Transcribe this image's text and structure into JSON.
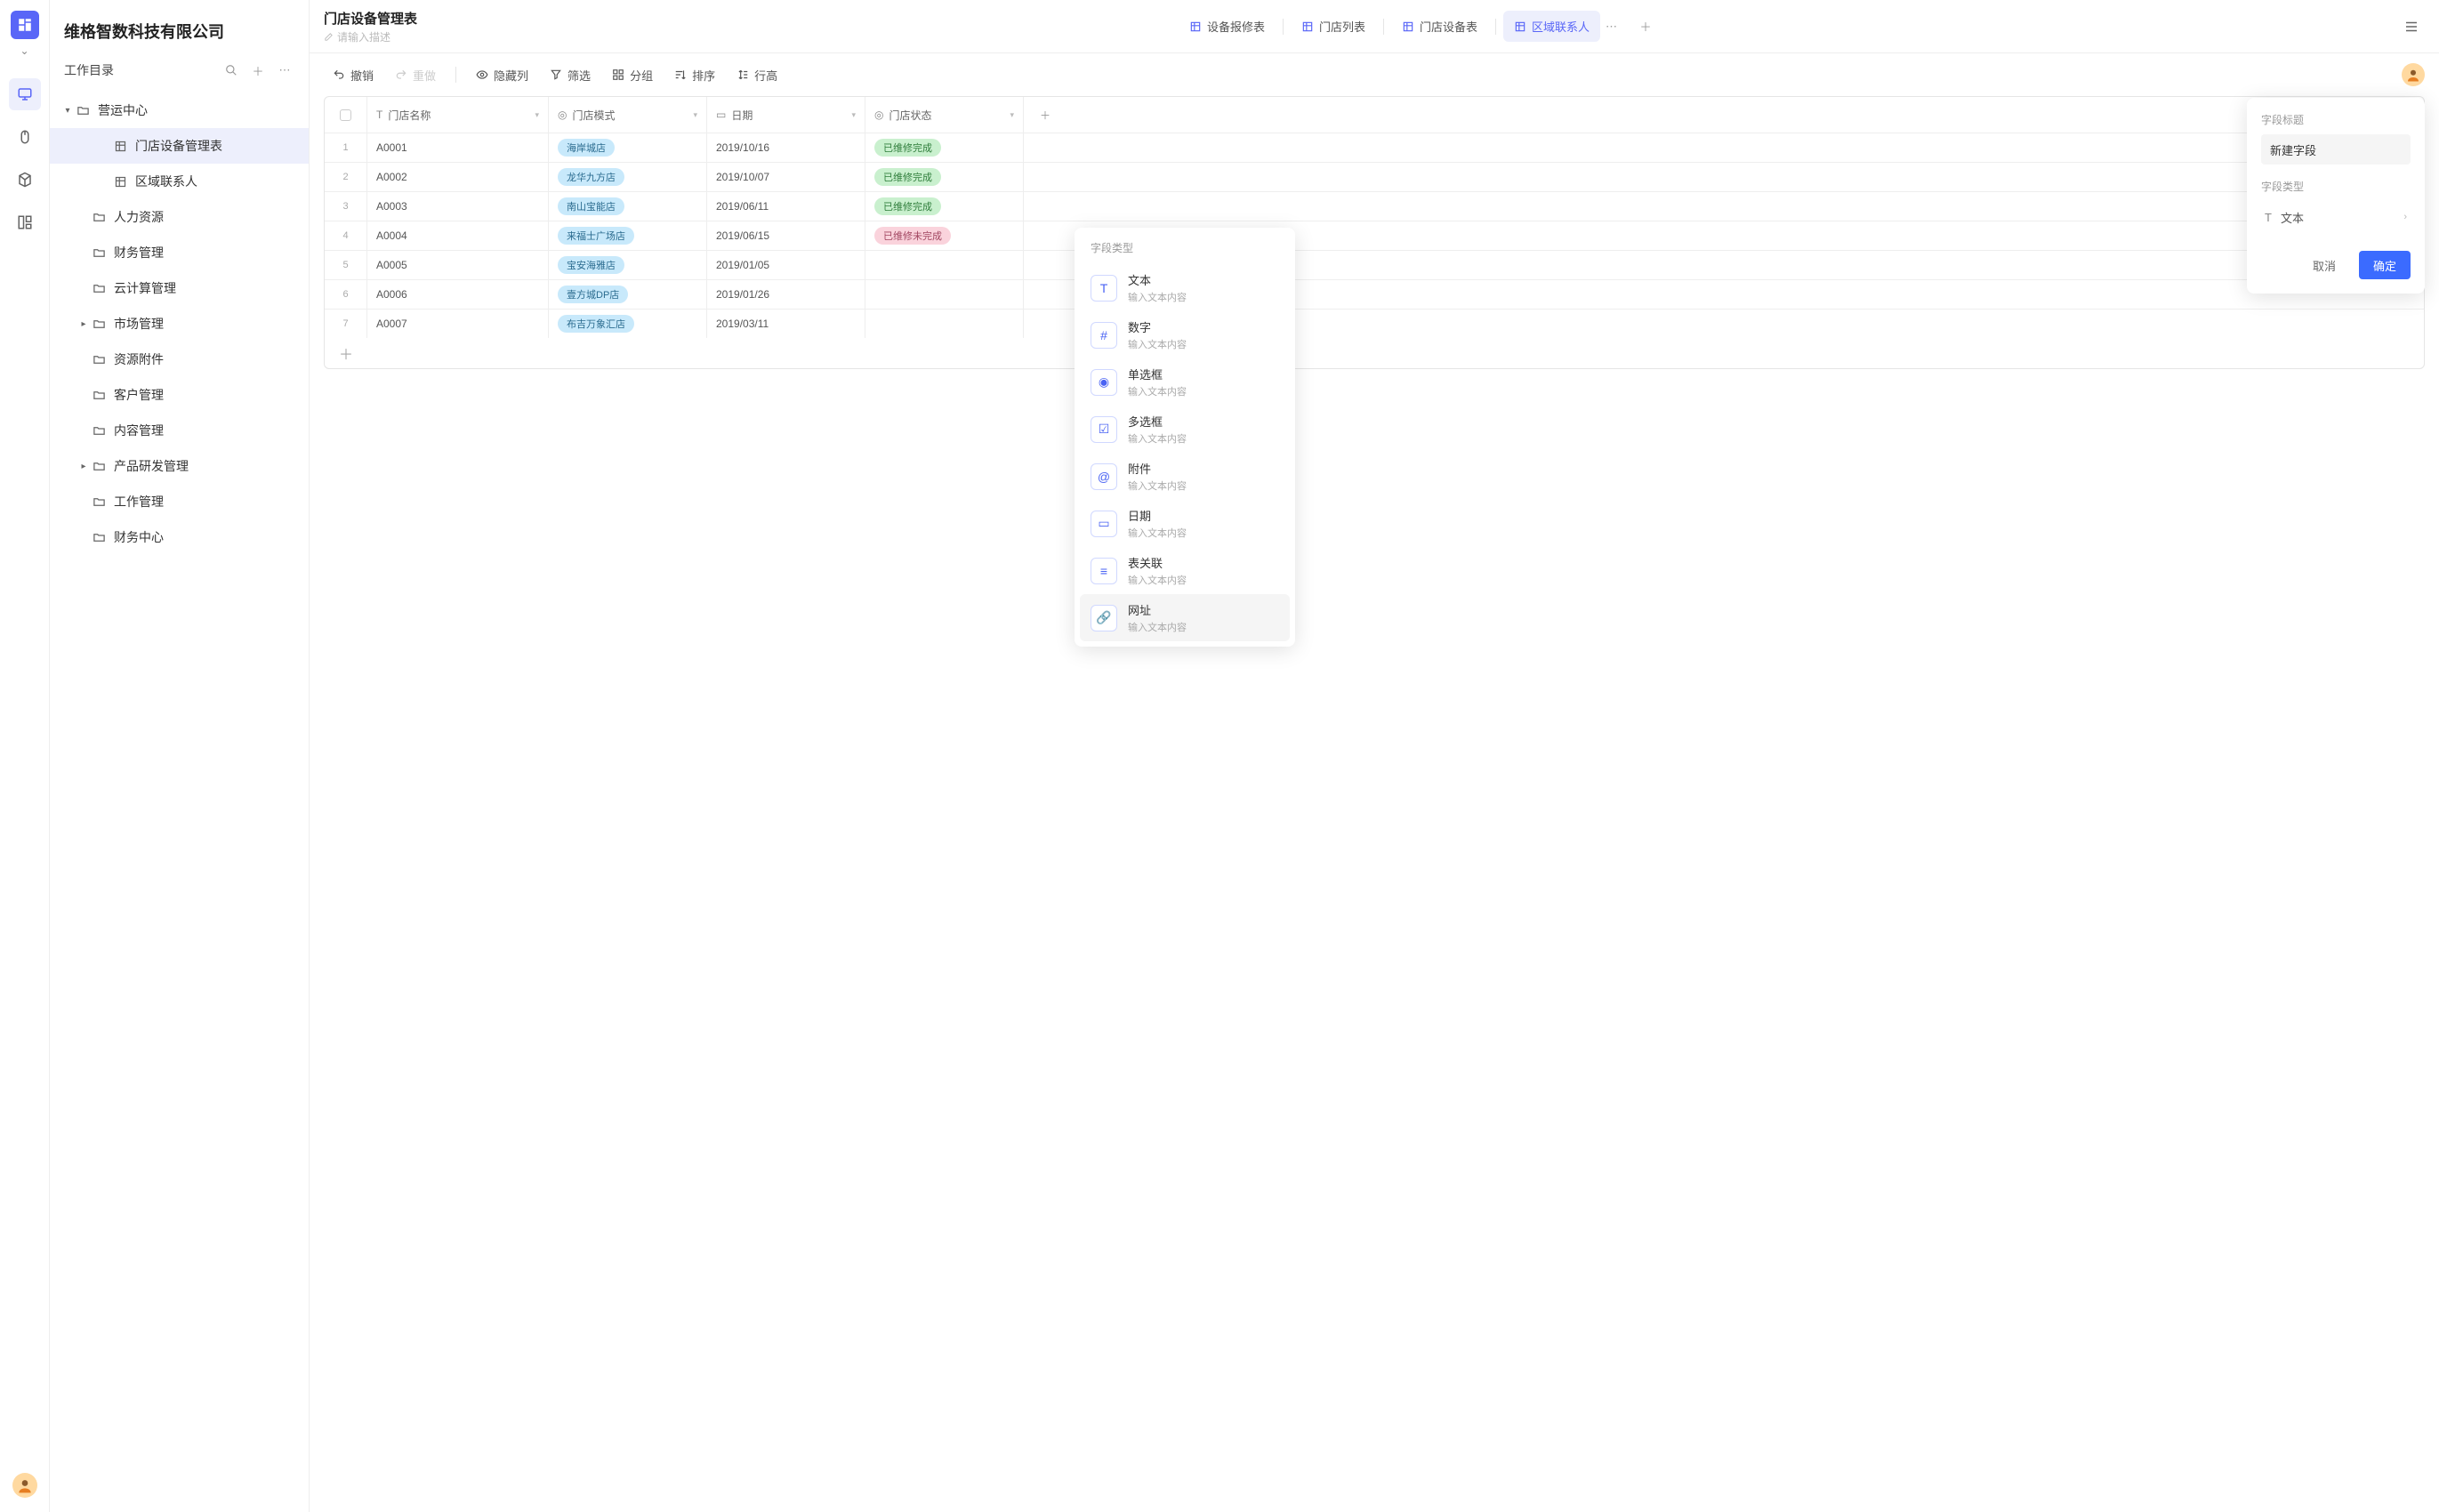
{
  "workspace": {
    "name": "维格智数科技有限公司"
  },
  "catalog": {
    "label": "工作目录"
  },
  "tree": {
    "root": "营运中心",
    "active": "门店设备管理表",
    "nodes": [
      {
        "label": "门店设备管理表",
        "type": "sheet",
        "active": true
      },
      {
        "label": "区域联系人",
        "type": "sheet"
      },
      {
        "label": "人力资源",
        "type": "folder"
      },
      {
        "label": "财务管理",
        "type": "folder"
      },
      {
        "label": "云计算管理",
        "type": "folder"
      },
      {
        "label": "市场管理",
        "type": "folder",
        "expandable": true
      },
      {
        "label": "资源附件",
        "type": "folder"
      },
      {
        "label": "客户管理",
        "type": "folder"
      },
      {
        "label": "内容管理",
        "type": "folder"
      },
      {
        "label": "产品研发管理",
        "type": "folder",
        "expandable": true
      },
      {
        "label": "工作管理",
        "type": "folder"
      },
      {
        "label": "财务中心",
        "type": "folder"
      }
    ]
  },
  "header": {
    "title": "门店设备管理表",
    "desc_placeholder": "请输入描述",
    "views": [
      {
        "label": "设备报修表"
      },
      {
        "label": "门店列表"
      },
      {
        "label": "门店设备表"
      },
      {
        "label": "区域联系人",
        "active": true
      }
    ]
  },
  "toolbar": {
    "undo": "撤销",
    "redo": "重做",
    "hide": "隐藏列",
    "filter": "筛选",
    "group": "分组",
    "sort": "排序",
    "rowheight": "行高"
  },
  "grid": {
    "columns": [
      "门店名称",
      "门店模式",
      "日期",
      "门店状态"
    ],
    "rows": [
      {
        "c0": "A0001",
        "c1": "海岸城店",
        "c2": "2019/10/16",
        "c3": "已维修完成",
        "status": "green"
      },
      {
        "c0": "A0002",
        "c1": "龙华九方店",
        "c2": "2019/10/07",
        "c3": "已维修完成",
        "status": "green"
      },
      {
        "c0": "A0003",
        "c1": "南山宝能店",
        "c2": "2019/06/11",
        "c3": "已维修完成",
        "status": "green"
      },
      {
        "c0": "A0004",
        "c1": "来福士广场店",
        "c2": "2019/06/15",
        "c3": "已维修未完成",
        "status": "pink"
      },
      {
        "c0": "A0005",
        "c1": "宝安海雅店",
        "c2": "2019/01/05",
        "c3": "",
        "status": ""
      },
      {
        "c0": "A0006",
        "c1": "壹方城DP店",
        "c2": "2019/01/26",
        "c3": "",
        "status": ""
      },
      {
        "c0": "A0007",
        "c1": "布吉万象汇店",
        "c2": "2019/03/11",
        "c3": "",
        "status": ""
      }
    ]
  },
  "panel": {
    "title_label": "字段标题",
    "title_value": "新建字段",
    "type_label": "字段类型",
    "type_value": "文本",
    "cancel": "取消",
    "ok": "确定"
  },
  "ftmenu": {
    "label": "字段类型",
    "items": [
      {
        "name": "文本",
        "sub": "输入文本内容",
        "icon": "T"
      },
      {
        "name": "数字",
        "sub": "输入文本内容",
        "icon": "#"
      },
      {
        "name": "单选框",
        "sub": "输入文本内容",
        "icon": "◉"
      },
      {
        "name": "多选框",
        "sub": "输入文本内容",
        "icon": "☑"
      },
      {
        "name": "附件",
        "sub": "输入文本内容",
        "icon": "@"
      },
      {
        "name": "日期",
        "sub": "输入文本内容",
        "icon": "▭"
      },
      {
        "name": "表关联",
        "sub": "输入文本内容",
        "icon": "≡"
      },
      {
        "name": "网址",
        "sub": "输入文本内容",
        "icon": "🔗",
        "hover": true
      }
    ]
  }
}
